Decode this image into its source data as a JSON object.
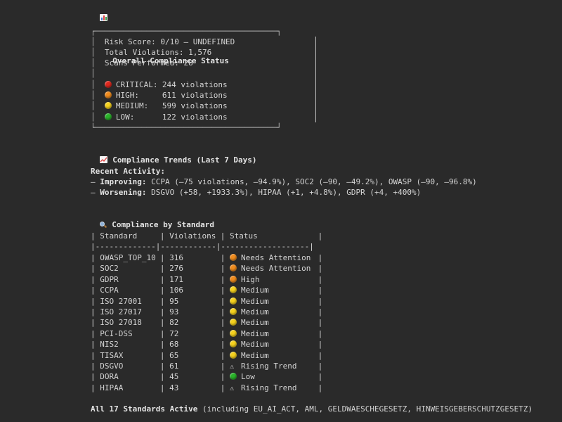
{
  "overall": {
    "title": "Overall Compliance Status",
    "icon": "bar-chart-icon",
    "risk_score": "Risk Score: 0/10 – UNDEFINED",
    "total_violations": "Total Violations: 1,576",
    "scans_performed": "Scans Performed: 28",
    "levels": [
      {
        "label": "CRITICAL:",
        "value": "244 violations",
        "color": "#e0281e",
        "icon": "red-circle-icon"
      },
      {
        "label": "HIGH:",
        "value": "611 violations",
        "color": "#f08c1e",
        "icon": "orange-circle-icon"
      },
      {
        "label": "MEDIUM:",
        "value": "599 violations",
        "color": "#f6d21e",
        "icon": "yellow-circle-icon"
      },
      {
        "label": "LOW:",
        "value": "122 violations",
        "color": "#2ab32a",
        "icon": "green-circle-icon"
      }
    ]
  },
  "trends": {
    "title": "Compliance Trends (Last 7 Days)",
    "icon": "trend-chart-icon",
    "recent_label": "Recent Activity:",
    "improving_label": "Improving:",
    "improving_text": "CCPA (–75 violations, –94.9%), SOC2 (–90, –49.2%), OWASP (–90, –96.8%)",
    "worsening_label": "Worsening:",
    "worsening_text": "DSGVO (+58, +1933.3%), HIPAA (+1, +4.8%), GDPR (+4, +400%)"
  },
  "standards": {
    "title": "Compliance by Standard",
    "icon": "magnifier-icon",
    "headers": [
      "Standard",
      "Violations",
      "Status"
    ],
    "rows": [
      {
        "standard": "OWASP_TOP_10",
        "violations": "316",
        "status": "Needs Attention",
        "marker": "orange"
      },
      {
        "standard": "SOC2",
        "violations": "276",
        "status": "Needs Attention",
        "marker": "orange"
      },
      {
        "standard": "GDPR",
        "violations": "171",
        "status": "High",
        "marker": "orange"
      },
      {
        "standard": "CCPA",
        "violations": "106",
        "status": "Medium",
        "marker": "yellow"
      },
      {
        "standard": "ISO 27001",
        "violations": "95",
        "status": "Medium",
        "marker": "yellow"
      },
      {
        "standard": "ISO 27017",
        "violations": "93",
        "status": "Medium",
        "marker": "yellow"
      },
      {
        "standard": "ISO 27018",
        "violations": "82",
        "status": "Medium",
        "marker": "yellow"
      },
      {
        "standard": "PCI-DSS",
        "violations": "72",
        "status": "Medium",
        "marker": "yellow"
      },
      {
        "standard": "NIS2",
        "violations": "68",
        "status": "Medium",
        "marker": "yellow"
      },
      {
        "standard": "TISAX",
        "violations": "65",
        "status": "Medium",
        "marker": "yellow"
      },
      {
        "standard": "DSGVO",
        "violations": "61",
        "status": "Rising Trend",
        "marker": "warn"
      },
      {
        "standard": "DORA",
        "violations": "45",
        "status": "Low",
        "marker": "green"
      },
      {
        "standard": "HIPAA",
        "violations": "43",
        "status": "Rising Trend",
        "marker": "warn"
      }
    ]
  },
  "footer": {
    "bold": "All 17 Standards Active",
    "text": " (including EU_AI_ACT, AML, GELDWAESCHEGESETZ, HINWEISGEBERSCHUTZGESETZ)"
  }
}
